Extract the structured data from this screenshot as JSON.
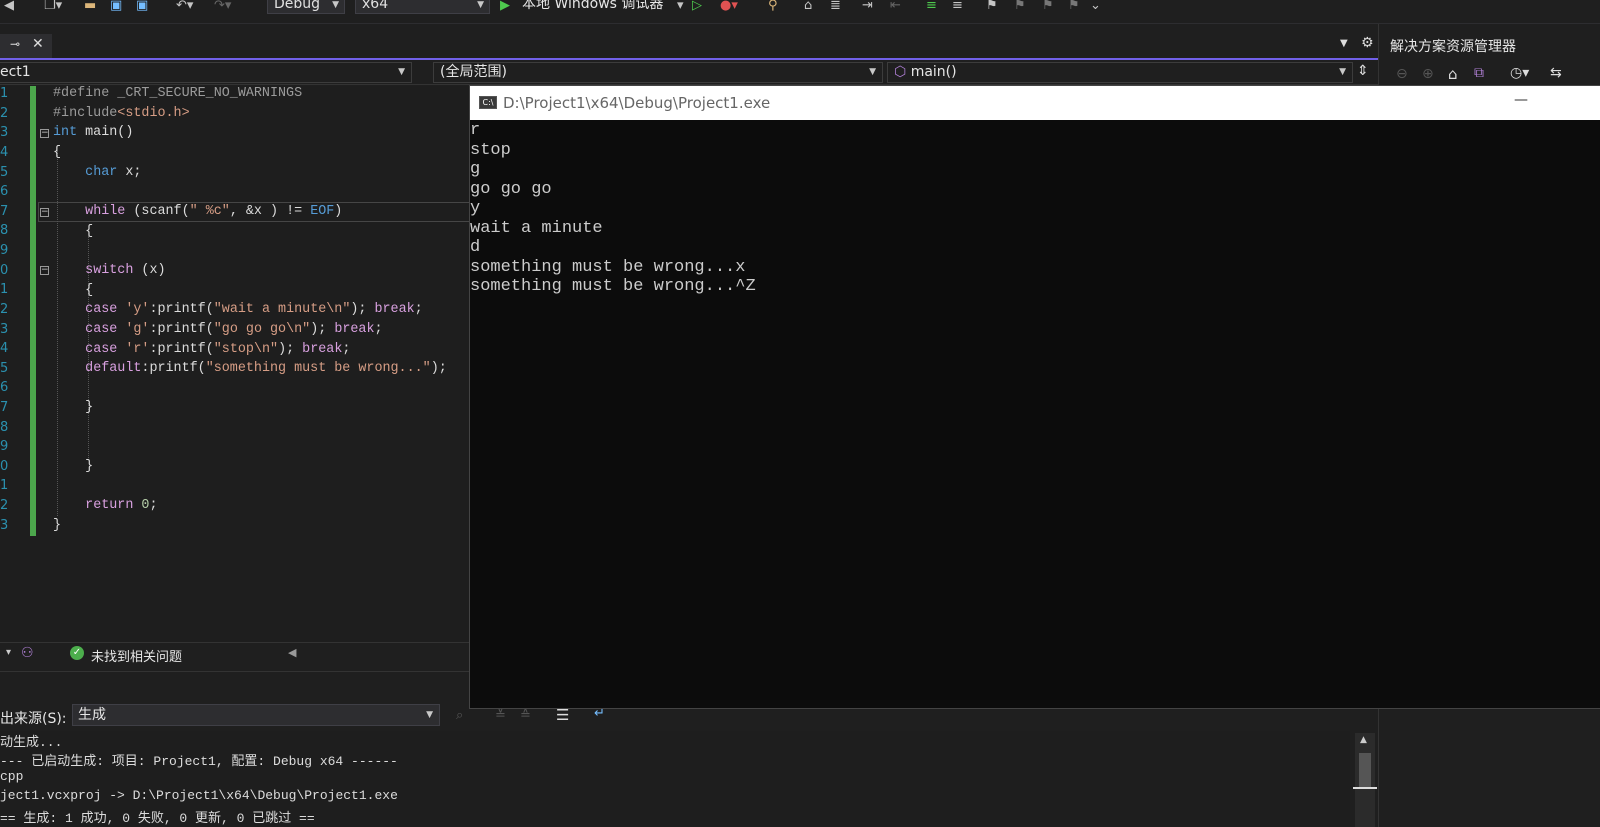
{
  "toolbar": {
    "config": "Debug",
    "platform": "x64",
    "run_label": "本地 Windows 调试器"
  },
  "navbar": {
    "project": "ect1",
    "scope": "(全局范围)",
    "member": "main()"
  },
  "solution_explorer": {
    "title": "解决方案资源管理器"
  },
  "editor": {
    "line_numbers": [
      "1",
      "2",
      "3",
      "4",
      "5",
      "6",
      "7",
      "8",
      "9",
      "0",
      "1",
      "2",
      "3",
      "4",
      "5",
      "6",
      "7",
      "8",
      "9",
      "0",
      "1",
      "2",
      "3"
    ]
  },
  "status": {
    "issues_text": "未找到相关问题"
  },
  "output": {
    "source_label": "出来源(S):",
    "source_value": "生成",
    "lines": [
      "动生成...",
      "--- 已启动生成: 项目: Project1, 配置: Debug x64 ------",
      "cpp",
      "ject1.vcxproj -> D:\\Project1\\x64\\Debug\\Project1.exe",
      "== 生成: 1 成功, 0 失败, 0 更新, 0 已跳过 =="
    ]
  },
  "console": {
    "title": "D:\\Project1\\x64\\Debug\\Project1.exe",
    "lines": [
      "r",
      "stop",
      "g",
      "go go go",
      "y",
      "wait a minute",
      "d",
      "something must be wrong...x",
      "something must be wrong...^Z"
    ]
  }
}
